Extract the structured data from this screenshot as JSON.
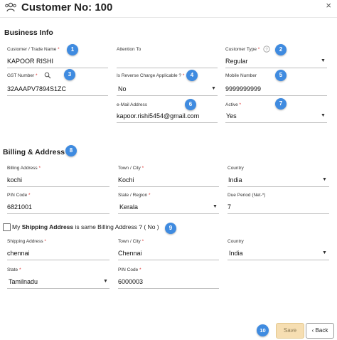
{
  "header": {
    "title": "Customer No: 100",
    "close": "×"
  },
  "business_info": {
    "heading": "Business Info",
    "customer_name": {
      "label": "Customer / Trade Name",
      "req": "*",
      "value": "KAPOOR RISHI",
      "badge": "1"
    },
    "attention_to": {
      "label": "Attention To",
      "value": ""
    },
    "customer_type": {
      "label": "Customer Type",
      "req": "*",
      "value": "Regular",
      "badge": "2"
    },
    "gst_number": {
      "label": "GST Number",
      "req": "*",
      "value": "32AAAPV7894S1ZC",
      "badge": "3"
    },
    "reverse_charge": {
      "label": "Is Reverse Charge Applicable ?",
      "req": "*",
      "value": "No",
      "badge": "4"
    },
    "mobile": {
      "label": "Mobile Number",
      "value": "9999999999",
      "badge": "5"
    },
    "email": {
      "label": "e-Mail Address",
      "value": "kapoor.rishi5454@gmail.com",
      "badge": "6"
    },
    "active": {
      "label": "Active",
      "req": "*",
      "value": "Yes",
      "badge": "7"
    }
  },
  "billing": {
    "heading": "Billing & Address",
    "badge": "8",
    "address": {
      "label": "Billing Address",
      "req": "*",
      "value": "kochi"
    },
    "town": {
      "label": "Town / City",
      "req": "*",
      "value": "Kochi"
    },
    "country": {
      "label": "Country",
      "value": "India"
    },
    "pin": {
      "label": "PIN Code",
      "req": "*",
      "value": "6821001"
    },
    "state": {
      "label": "State / Region",
      "req": "*",
      "value": "Kerala"
    },
    "due_period": {
      "label": "Due Period (Net-*)",
      "value": "7"
    }
  },
  "shipping_same": {
    "prefix": "My",
    "bold": "Shipping Address",
    "suffix": "is same Billing Address ? ( No )",
    "badge": "9"
  },
  "shipping": {
    "address": {
      "label": "Shipping Address",
      "req": "*",
      "value": "chennai"
    },
    "town": {
      "label": "Town / City",
      "req": "*",
      "value": "Chennai"
    },
    "country": {
      "label": "Country",
      "value": "India"
    },
    "state": {
      "label": "State",
      "req": "*",
      "value": "Tamilnadu"
    },
    "pin": {
      "label": "PIN Code",
      "req": "*",
      "value": "6000003"
    }
  },
  "footer": {
    "badge": "10",
    "save": "Save",
    "back": "Back"
  }
}
